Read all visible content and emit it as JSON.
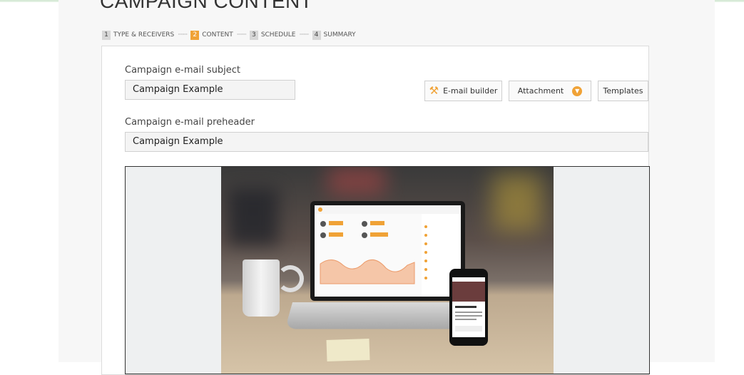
{
  "page_title": "CAMPAIGN CONTENT",
  "steps": [
    {
      "num": "1",
      "label": "TYPE & RECEIVERS",
      "active": false
    },
    {
      "num": "2",
      "label": "CONTENT",
      "active": true
    },
    {
      "num": "3",
      "label": "SCHEDULE",
      "active": false
    },
    {
      "num": "4",
      "label": "SUMMARY",
      "active": false
    }
  ],
  "step_separator": "·······",
  "subject": {
    "label": "Campaign e-mail subject",
    "value": "Campaign Example"
  },
  "preheader": {
    "label": "Campaign e-mail preheader",
    "value": "Campaign Example"
  },
  "buttons": {
    "email_builder": "E-mail builder",
    "attachment": "Attachment",
    "templates": "Templates"
  },
  "icons": {
    "email_builder": "tools-icon",
    "attachment": "chevron-down-icon"
  },
  "colors": {
    "accent": "#f0a236"
  }
}
